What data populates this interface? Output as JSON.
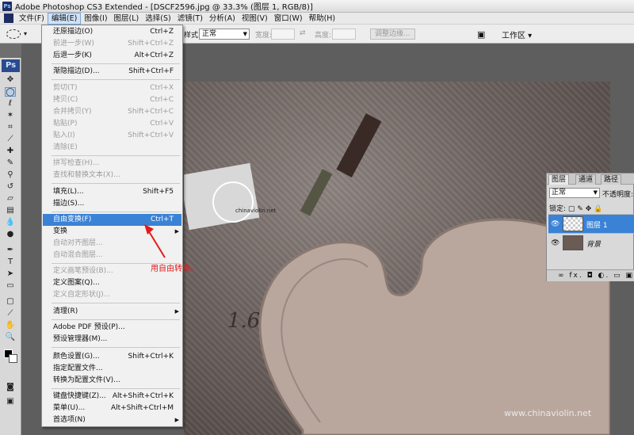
{
  "titlebar": {
    "icon": "Ps",
    "text": "Adobe Photoshop CS3 Extended - [DSCF2596.jpg @ 33.3% (图层 1, RGB/8)]"
  },
  "menubar": {
    "items": [
      "文件(F)",
      "编辑(E)",
      "图像(I)",
      "图层(L)",
      "选择(S)",
      "滤镜(T)",
      "分析(A)",
      "视图(V)",
      "窗口(W)",
      "帮助(H)"
    ],
    "active_index": 1
  },
  "options": {
    "style_label": "样式:",
    "style_value": "正常",
    "width_label": "宽度:",
    "height_label": "高度:",
    "refine_button": "调整边缘...",
    "workspace": "工作区"
  },
  "toolbox": {
    "badge": "Ps"
  },
  "edit_menu": {
    "items": [
      {
        "label": "还原描边(O)",
        "shortcut": "Ctrl+Z",
        "disabled": false
      },
      {
        "label": "前进一步(W)",
        "shortcut": "Shift+Ctrl+Z",
        "disabled": true
      },
      {
        "label": "后退一步(K)",
        "shortcut": "Alt+Ctrl+Z",
        "disabled": false
      },
      {
        "label": "渐隐描边(D)...",
        "shortcut": "Shift+Ctrl+F",
        "disabled": false
      },
      {
        "label": "剪切(T)",
        "shortcut": "Ctrl+X",
        "disabled": true
      },
      {
        "label": "拷贝(C)",
        "shortcut": "Ctrl+C",
        "disabled": true
      },
      {
        "label": "合并拷贝(Y)",
        "shortcut": "Shift+Ctrl+C",
        "disabled": true
      },
      {
        "label": "粘贴(P)",
        "shortcut": "Ctrl+V",
        "disabled": true
      },
      {
        "label": "贴入(I)",
        "shortcut": "Shift+Ctrl+V",
        "disabled": true
      },
      {
        "label": "清除(E)",
        "shortcut": "",
        "disabled": true
      },
      {
        "label": "拼写检查(H)...",
        "shortcut": "",
        "disabled": true
      },
      {
        "label": "查找和替换文本(X)...",
        "shortcut": "",
        "disabled": true
      },
      {
        "label": "填充(L)...",
        "shortcut": "Shift+F5",
        "disabled": false
      },
      {
        "label": "描边(S)...",
        "shortcut": "",
        "disabled": false
      },
      {
        "label": "自由变换(F)",
        "shortcut": "Ctrl+T",
        "disabled": false,
        "highlighted": true
      },
      {
        "label": "变换",
        "shortcut": "",
        "disabled": false,
        "submenu": true
      },
      {
        "label": "自动对齐图层...",
        "shortcut": "",
        "disabled": true
      },
      {
        "label": "自动混合图层...",
        "shortcut": "",
        "disabled": true
      },
      {
        "label": "定义画笔预设(B)...",
        "shortcut": "",
        "disabled": true
      },
      {
        "label": "定义图案(Q)...",
        "shortcut": "",
        "disabled": false
      },
      {
        "label": "定义自定形状(J)...",
        "shortcut": "",
        "disabled": true
      },
      {
        "label": "清理(R)",
        "shortcut": "",
        "disabled": false,
        "submenu": true
      },
      {
        "label": "Adobe PDF 预设(P)...",
        "shortcut": "",
        "disabled": false
      },
      {
        "label": "预设管理器(M)...",
        "shortcut": "",
        "disabled": false
      },
      {
        "label": "颜色设置(G)...",
        "shortcut": "Shift+Ctrl+K",
        "disabled": false
      },
      {
        "label": "指定配置文件...",
        "shortcut": "",
        "disabled": false
      },
      {
        "label": "转换为配置文件(V)...",
        "shortcut": "",
        "disabled": false
      },
      {
        "label": "键盘快捷键(Z)...",
        "shortcut": "Alt+Shift+Ctrl+K",
        "disabled": false
      },
      {
        "label": "菜单(U)...",
        "shortcut": "Alt+Shift+Ctrl+M",
        "disabled": false
      },
      {
        "label": "首选项(N)",
        "shortcut": "",
        "disabled": false,
        "submenu": true
      }
    ]
  },
  "annotation": {
    "text": "用自由转换。",
    "color": "#e31b1b"
  },
  "layers_panel": {
    "tabs": [
      "图层",
      "通道",
      "路径"
    ],
    "blend_mode": "正常",
    "opacity_label": "不透明度:",
    "lock_label": "锁定:",
    "layers": [
      {
        "name": "图层 1",
        "selected": true
      },
      {
        "name": "背景",
        "selected": false
      }
    ],
    "footer_icons": "∞ fx. ◘ ◐. ▭ ▣ ▥"
  },
  "photo": {
    "canvas_text": "1.6",
    "paper_text": "chinaviolin.net"
  },
  "watermark": "www.chinaviolin.net",
  "colors": {
    "accent": "#3a82d5",
    "annotation": "#e31b1b"
  }
}
